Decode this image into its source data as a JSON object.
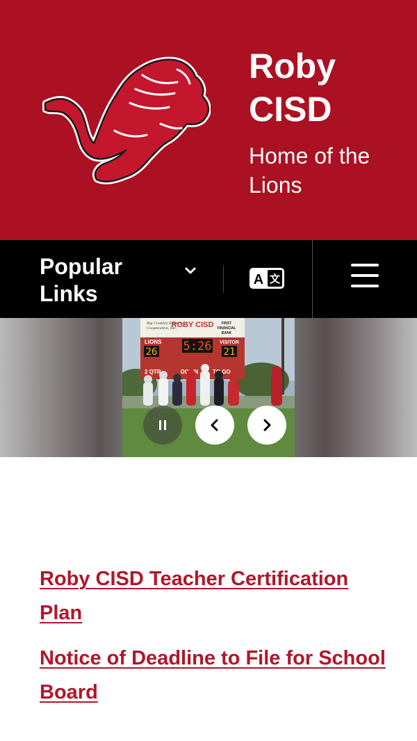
{
  "header": {
    "title": "Roby CISD",
    "tagline": "Home of the Lions",
    "logo_icon": "lion-logo"
  },
  "nav": {
    "popular_links_label": "Popular Links",
    "dropdown_icon": "chevron-down-icon",
    "translate_icon": "translate-icon",
    "menu_icon": "hamburger-menu-icon"
  },
  "slider": {
    "scoreboard": {
      "sponsor_left": "Big Country Electric Cooperative, Inc.",
      "title": "ROBY CISD",
      "sponsor_right": "FIRST FINANCIAL BANK",
      "home_label": "LIONS",
      "home_score": "26",
      "clock": "5:26",
      "visitor_label": "VISITOR",
      "visitor_score": "21",
      "quarter": "2 QTR",
      "down_label": "DOWN",
      "to_go_label": "TO GO"
    }
  },
  "announcements": [
    {
      "label": "Roby CISD Teacher Certification Plan"
    },
    {
      "label": "Notice of Deadline to File for School Board"
    }
  ],
  "colors": {
    "brand_red": "#ac1023",
    "link_red": "#b1162a",
    "nav_black": "#000000"
  }
}
